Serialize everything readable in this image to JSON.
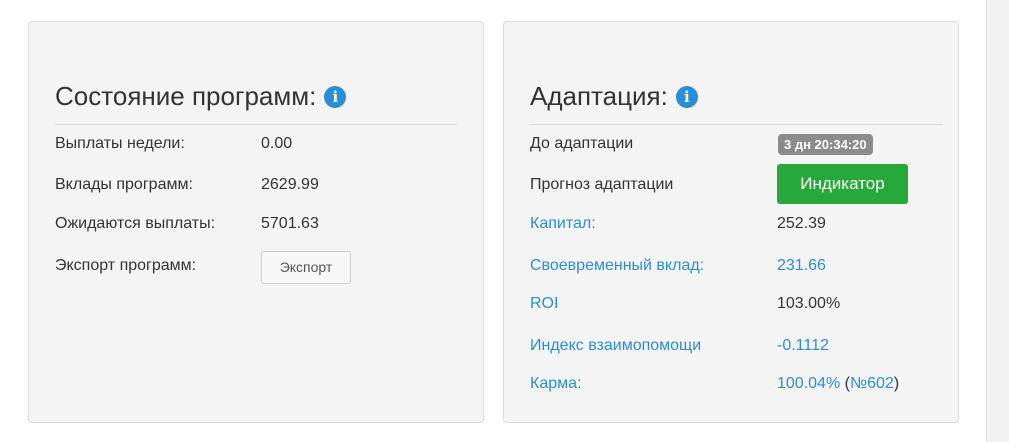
{
  "status_panel": {
    "title": "Состояние программ:",
    "rows": [
      {
        "label": "Выплаты недели:",
        "value": "0.00"
      },
      {
        "label": "Вклады программ:",
        "value": "2629.99"
      },
      {
        "label": "Ожидаются выплаты:",
        "value": "5701.63"
      },
      {
        "label": "Экспорт программ:"
      }
    ],
    "export_button": "Экспорт"
  },
  "adaptation_panel": {
    "title": "Адаптация:",
    "before_label": "До адаптации",
    "before_value": "3 дн 20:34:20",
    "forecast_label": "Прогноз адаптации",
    "indicator_button": "Индикатор",
    "rows": [
      {
        "label": "Капитал:",
        "value": "252.39"
      },
      {
        "label": "Своевременный вклад:",
        "value": "231.66"
      },
      {
        "label": "ROI",
        "value": "103.00%"
      },
      {
        "label": "Индекс взаимопомощи",
        "value": "-0.1112"
      },
      {
        "label": "Карма:",
        "value": "100.04%",
        "rank": "№602"
      }
    ]
  },
  "colors": {
    "link": "#2a8ed7",
    "button_green": "#27a83a",
    "badge_gray": "#8b8b8b",
    "panel_bg": "#f4f4f4"
  },
  "icons": [
    "info-icon",
    "info-icon"
  ]
}
